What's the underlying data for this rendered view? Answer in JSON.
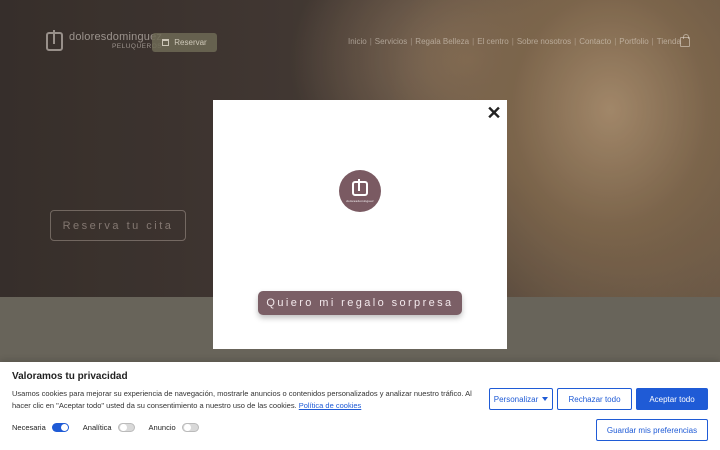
{
  "header": {
    "logo_name": "doloresdominguez",
    "logo_sub": "PELUQUEROS",
    "reserve_label": "Reservar",
    "nav": [
      "Inicio",
      "Servicios",
      "Regala Belleza",
      "El centro",
      "Sobre nosotros",
      "Contacto",
      "Portfolio",
      "Tienda"
    ]
  },
  "hero": {
    "cta_label": "Reserva tu cita"
  },
  "modal": {
    "close_label": "✕",
    "badge_text": "doloresdominguez",
    "gift_label": "Quiero mi regalo sorpresa"
  },
  "cookies": {
    "title": "Valoramos tu privacidad",
    "text": "Usamos cookies para mejorar su experiencia de navegación, mostrarle anuncios o contenidos personalizados y analizar nuestro tráfico. Al hacer clic en \"Aceptar todo\" usted da su consentimiento a nuestro uso de las cookies.",
    "link": "Política de cookies",
    "toggles": [
      {
        "label": "Necesaria",
        "state": "on"
      },
      {
        "label": "Analítica",
        "state": "off"
      },
      {
        "label": "Anuncio",
        "state": "off"
      }
    ],
    "customize_label": "Personalizar",
    "reject_label": "Rechazar todo",
    "accept_label": "Aceptar todo",
    "save_label": "Guardar mis preferencias"
  },
  "colors": {
    "accent": "#1f5bd6",
    "brand": "#7b5f66"
  }
}
